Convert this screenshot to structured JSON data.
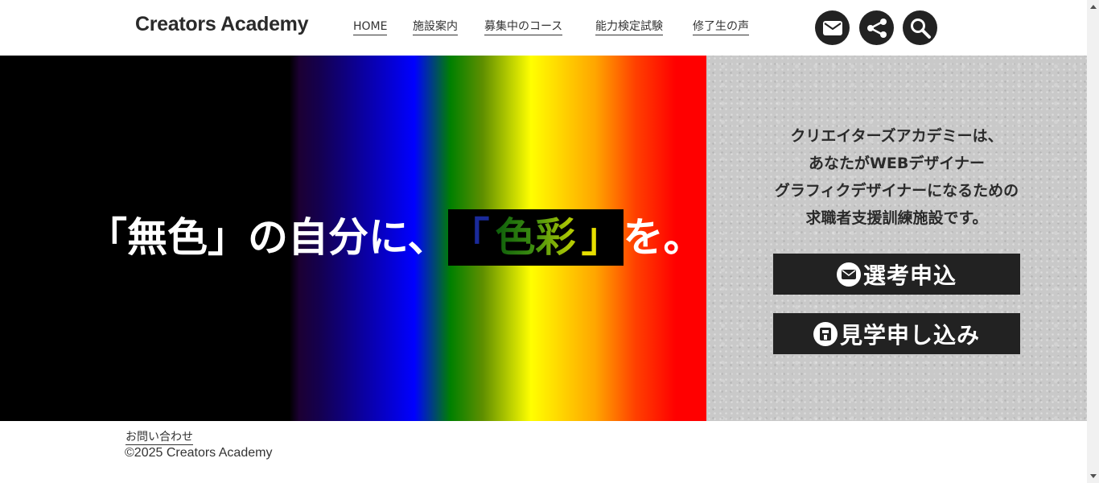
{
  "header": {
    "logo": "Creators Academy",
    "nav": [
      "HOME",
      "施設案内",
      "募集中のコース",
      "能力検定試験",
      "修了生の声"
    ],
    "icons": [
      "mail-icon",
      "share-icon",
      "search-icon"
    ]
  },
  "hero": {
    "catch_prefix": "「無色」の自分に、",
    "catch_open": "「",
    "catch_highlight": "色彩",
    "catch_close": "」",
    "catch_suffix": "を。"
  },
  "side": {
    "lines": [
      "クリエイターズアカデミーは、",
      "あなたがWEBデザイナー",
      "グラフィクデザイナーになるための",
      "求職者支援訓練施設です。"
    ],
    "apply_label": "選考申込",
    "tour_label": "見学申し込み"
  },
  "footer": {
    "contact": "お問い合わせ",
    "copyright": "©2025 Creators Academy"
  },
  "colors": {
    "accent": "#222222",
    "hero_end": "#ff0000"
  }
}
